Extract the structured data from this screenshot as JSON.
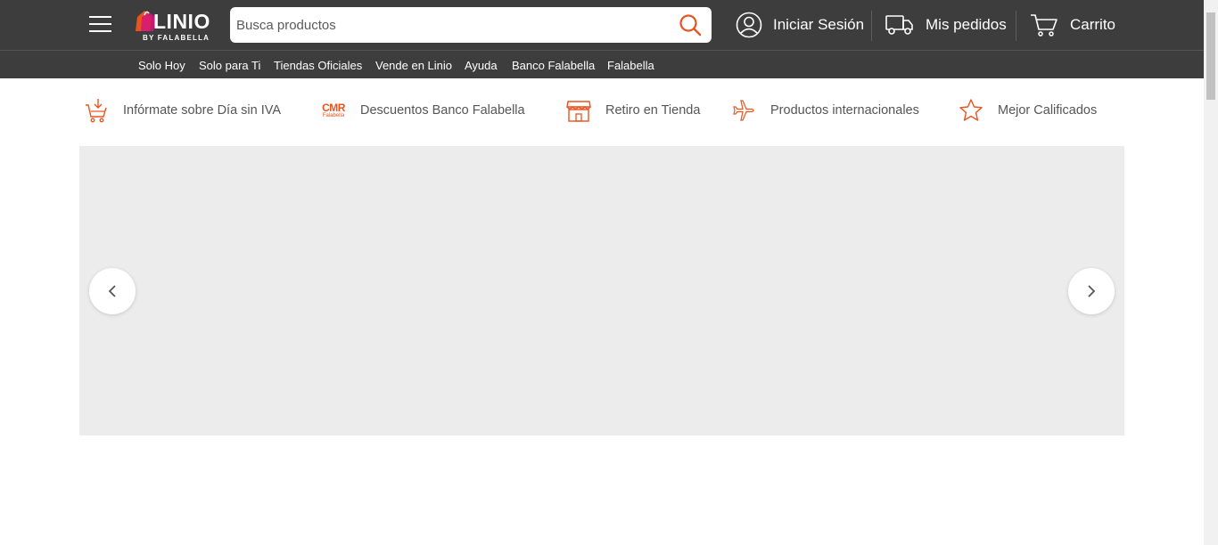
{
  "brand": {
    "name": "LINIO",
    "sub": "BY FALABELLA",
    "accent": "#e8541e",
    "header_bg": "#3d3d3d"
  },
  "search": {
    "placeholder": "Busca productos",
    "value": ""
  },
  "header": {
    "login_label": "Iniciar Sesión",
    "orders_label": "Mis pedidos",
    "cart_label": "Carrito"
  },
  "subnav": {
    "items": [
      {
        "label": "Solo Hoy"
      },
      {
        "label": "Solo para Ti"
      },
      {
        "label": "Tiendas Oficiales"
      },
      {
        "label": "Vende en Linio"
      },
      {
        "label": "Ayuda"
      },
      {
        "label": "Banco Falabella"
      },
      {
        "label": "Falabella"
      }
    ]
  },
  "features": {
    "items": [
      {
        "label": "Infórmate sobre Día sin IVA",
        "icon": "cart-tax-icon"
      },
      {
        "label": "Descuentos Banco Falabella",
        "icon": "cmr-falabella-icon",
        "icon_text": "CMR",
        "icon_subtext": "Falabella"
      },
      {
        "label": "Retiro en Tienda",
        "icon": "store-icon"
      },
      {
        "label": "Productos internacionales",
        "icon": "airplane-icon"
      },
      {
        "label": "Mejor Calificados",
        "icon": "star-icon"
      }
    ]
  },
  "banner": {
    "background": "#ececec"
  }
}
